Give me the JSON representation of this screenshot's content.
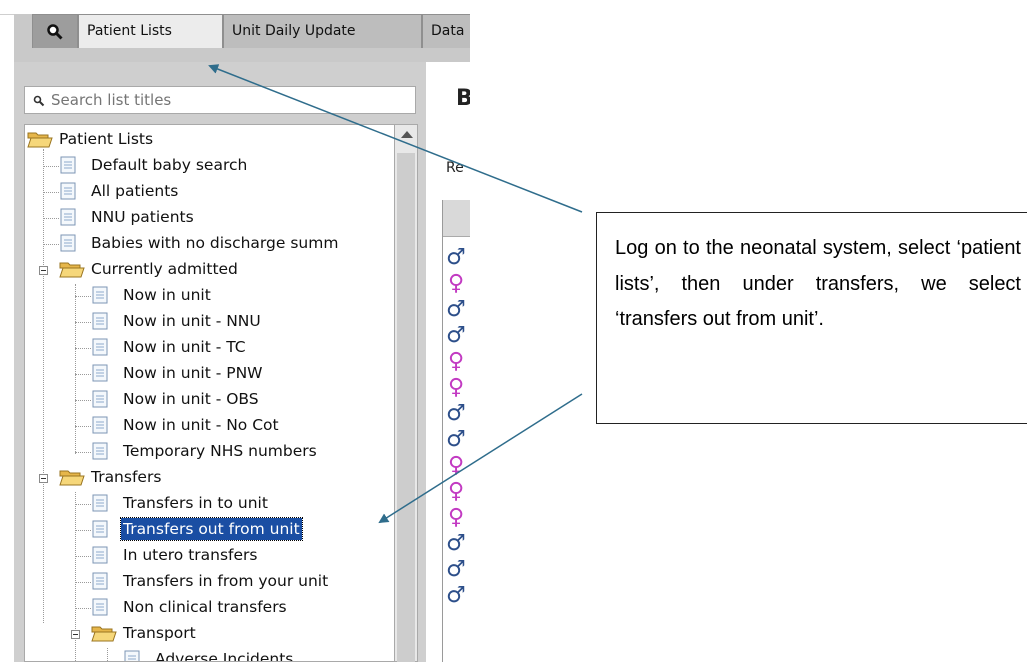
{
  "tabs": [
    {
      "label": "Patient Lists",
      "active": true
    },
    {
      "label": "Unit Daily Update",
      "active": false
    },
    {
      "label": "Data",
      "active": false
    }
  ],
  "search": {
    "placeholder": "Search list titles",
    "value": "Search list titles"
  },
  "tree": {
    "root": "Patient Lists",
    "root_items": [
      "Default baby search",
      "All patients",
      "NNU patients",
      "Babies with no discharge summ"
    ],
    "currently_admitted": {
      "label": "Currently admitted",
      "items": [
        "Now in unit",
        "Now in unit - NNU",
        "Now in unit - TC",
        "Now in unit - PNW",
        "Now in unit - OBS",
        "Now in unit - No Cot",
        "Temporary NHS numbers"
      ]
    },
    "transfers": {
      "label": "Transfers",
      "items": [
        "Transfers in to unit",
        "Transfers out from unit",
        "In utero transfers",
        "Transfers in from your unit",
        "Non clinical transfers"
      ],
      "selected": "Transfers out from unit",
      "transport": {
        "label": "Transport",
        "items": [
          "Adverse Incidents"
        ]
      }
    }
  },
  "right_pane": {
    "heading": "B",
    "sub": "Re"
  },
  "gender_column": [
    "male",
    "female",
    "male",
    "male",
    "female",
    "female",
    "male",
    "male",
    "female",
    "female",
    "female",
    "male",
    "male",
    "male"
  ],
  "callout": {
    "text": "Log on to the neonatal system, select ‘patient lists’, then under transfers, we select ‘transfers out from unit’."
  },
  "colors": {
    "male": "#2d4f8a",
    "female": "#c23ac2",
    "selection": "#1a4ea3",
    "arrow": "#2f6d8c"
  }
}
